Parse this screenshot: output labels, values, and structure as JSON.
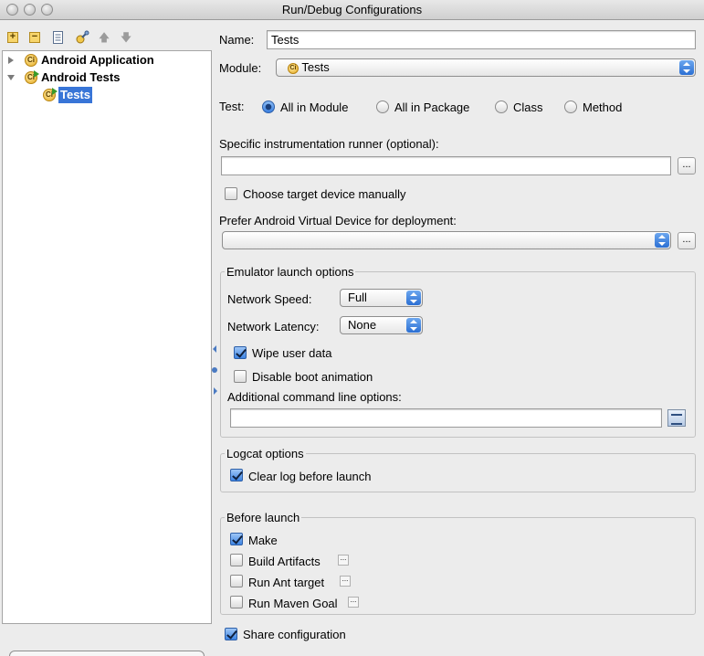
{
  "window": {
    "title": "Run/Debug Configurations"
  },
  "toolbar": {
    "icons": [
      "add-icon",
      "remove-icon",
      "copy-icon",
      "edit-defaults-icon",
      "move-up-icon",
      "move-down-icon"
    ],
    "add_glyph": "+",
    "remove_glyph": "−",
    "up_glyph": "🡅",
    "down_glyph": "🡇"
  },
  "tree": {
    "items": [
      {
        "label": "Android Application",
        "expanded": false
      },
      {
        "label": "Android Tests",
        "expanded": true
      },
      {
        "label": "Tests",
        "selected": true
      }
    ]
  },
  "form": {
    "name_label": "Name:",
    "name_value": "Tests",
    "module_label": "Module:",
    "module_value": "Tests",
    "test_label": "Test:",
    "test_options": [
      {
        "label": "All in Module",
        "selected": true
      },
      {
        "label": "All in Package",
        "selected": false
      },
      {
        "label": "Class",
        "selected": false
      },
      {
        "label": "Method",
        "selected": false
      }
    ],
    "runner_label": "Specific instrumentation runner (optional):",
    "runner_value": "",
    "choose_device_label": "Choose target device manually",
    "choose_device_checked": false,
    "avd_label": "Prefer Android Virtual Device for deployment:",
    "avd_value": "",
    "ellipsis": "..."
  },
  "emulator": {
    "title": "Emulator launch options",
    "speed_label": "Network Speed:",
    "speed_value": "Full",
    "latency_label": "Network Latency:",
    "latency_value": "None",
    "wipe_label": "Wipe user data",
    "wipe_checked": true,
    "boot_anim_label": "Disable boot animation",
    "boot_anim_checked": false,
    "cmdline_label": "Additional command line options:",
    "cmdline_value": ""
  },
  "logcat": {
    "title": "Logcat options",
    "clear_label": "Clear log before launch",
    "clear_checked": true
  },
  "before_launch": {
    "title": "Before launch",
    "items": [
      {
        "label": "Make",
        "checked": true,
        "has_options": false
      },
      {
        "label": "Build Artifacts",
        "checked": false,
        "has_options": true
      },
      {
        "label": "Run Ant target",
        "checked": false,
        "has_options": true
      },
      {
        "label": "Run Maven Goal",
        "checked": false,
        "has_options": true
      }
    ]
  },
  "share": {
    "label": "Share configuration",
    "checked": true
  },
  "colors": {
    "selection": "#3875d7",
    "window_bg": "#ececec"
  }
}
